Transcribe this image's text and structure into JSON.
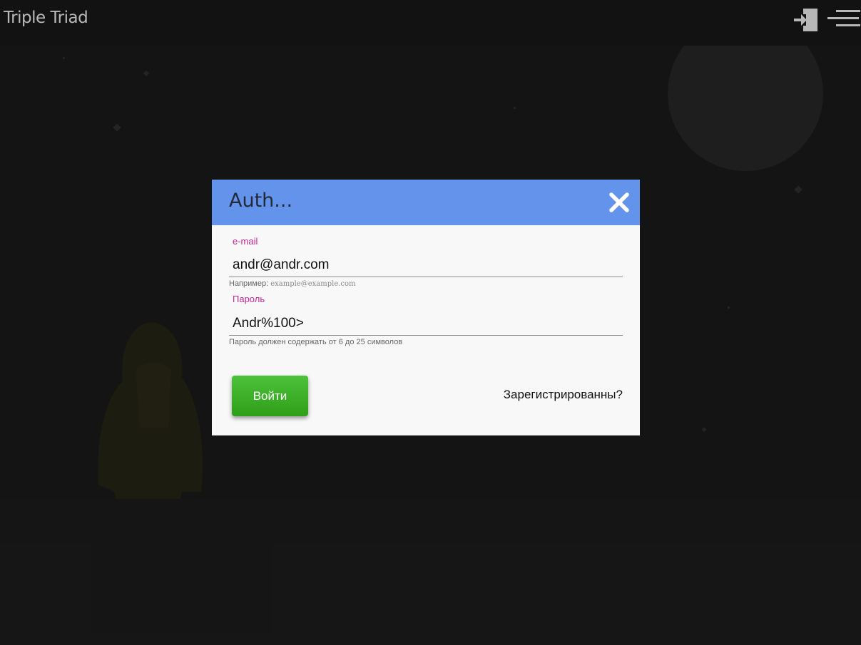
{
  "app": {
    "title": "Triple Triad"
  },
  "header": {
    "icons": {
      "login": "login-door-icon",
      "menu": "hamburger-menu-icon"
    }
  },
  "modal": {
    "title": "Auth...",
    "close_icon": "close-icon",
    "email": {
      "label": "e-mail",
      "value": "andr@andr.com",
      "hint_prefix": "Например:",
      "hint_example": "example@example.com"
    },
    "password": {
      "label": "Пароль",
      "value": "Andr%100>",
      "hint_before": "Пароль должен содержать от",
      "hint_min": "6",
      "hint_mid": "до",
      "hint_max": "25",
      "hint_after": "символов"
    },
    "submit_label": "Войти",
    "register_link": "Зарегистрированны?"
  },
  "colors": {
    "background": "#1c1c1d",
    "modal_header": "#6393ea",
    "label_accent": "#c8259b",
    "submit_button": "#36a81f"
  }
}
